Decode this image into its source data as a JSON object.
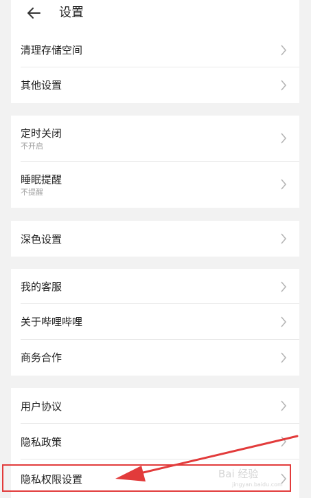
{
  "header": {
    "title": "设置"
  },
  "groups": [
    {
      "items": [
        {
          "label": "清理存储空间"
        },
        {
          "label": "其他设置"
        }
      ]
    },
    {
      "items": [
        {
          "label": "定时关闭",
          "sub": "不开启"
        },
        {
          "label": "睡眠提醒",
          "sub": "不提醒"
        }
      ]
    },
    {
      "items": [
        {
          "label": "深色设置"
        }
      ]
    },
    {
      "items": [
        {
          "label": "我的客服"
        },
        {
          "label": "关于哔哩哔哩"
        },
        {
          "label": "商务合作"
        }
      ]
    },
    {
      "items": [
        {
          "label": "用户协议"
        },
        {
          "label": "隐私政策"
        },
        {
          "label": "隐私权限设置"
        }
      ]
    }
  ],
  "annotation": {
    "color": "#e23b3b"
  },
  "watermark": {
    "text": "Bai 经验",
    "sub": "jingyan.baidu.com"
  },
  "colors": {
    "background": "#f2f2f2",
    "card": "#ffffff",
    "text": "#212121",
    "subtext": "#9e9e9e",
    "chevron": "#b5b5b5"
  }
}
